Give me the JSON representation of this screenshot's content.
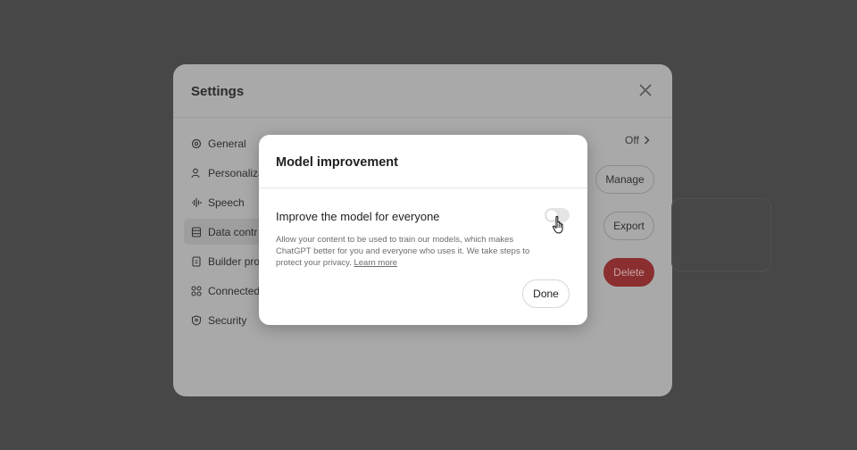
{
  "settings": {
    "title": "Settings",
    "nav": [
      {
        "label": "General",
        "icon": "gear-icon"
      },
      {
        "label": "Personaliza",
        "icon": "person-icon"
      },
      {
        "label": "Speech",
        "icon": "waveform-icon"
      },
      {
        "label": "Data contr",
        "icon": "database-icon"
      },
      {
        "label": "Builder pro",
        "icon": "id-card-icon"
      },
      {
        "label": "Connected",
        "icon": "apps-icon"
      },
      {
        "label": "Security",
        "icon": "shield-icon"
      }
    ],
    "off_label": "Off",
    "manage_label": "Manage",
    "export_label": "Export",
    "delete_label": "Delete"
  },
  "modal": {
    "title": "Model improvement",
    "toggle_label": "Improve the model for everyone",
    "description": "Allow your content to be used to train our models, which makes ChatGPT better for you and everyone who uses it. We take steps to protect your privacy.",
    "learn_more": "Learn more",
    "done_label": "Done",
    "toggle_on": false
  },
  "colors": {
    "overlay": "#474747",
    "delete": "#8a2e30"
  }
}
